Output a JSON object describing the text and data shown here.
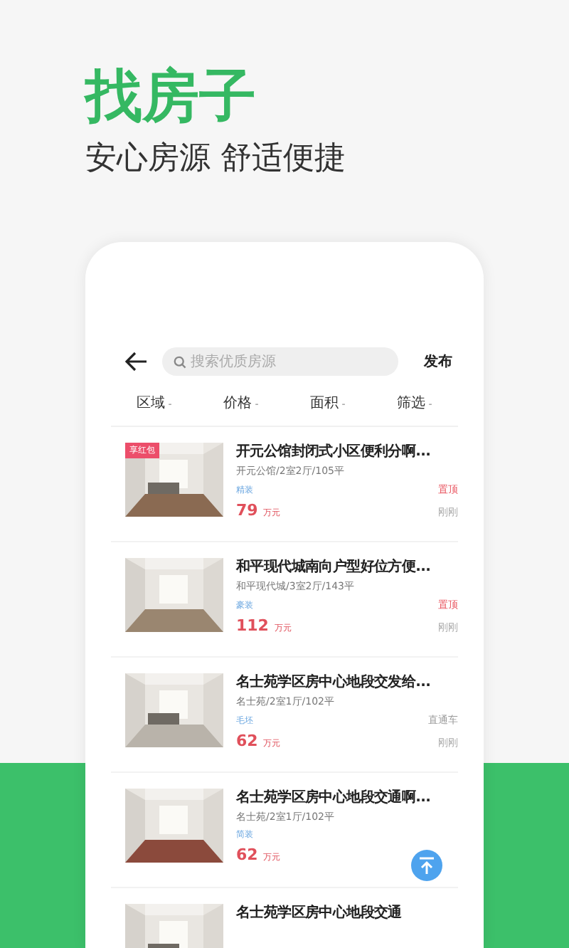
{
  "headline": "找房子",
  "tagline": "安心房源 舒适便捷",
  "header": {
    "search_placeholder": "搜索优质房源",
    "publish": "发布"
  },
  "filters": [
    {
      "label": "区域",
      "caret": "-"
    },
    {
      "label": "价格",
      "caret": "-"
    },
    {
      "label": "面积",
      "caret": "-"
    },
    {
      "label": "筛选",
      "caret": "-"
    }
  ],
  "listings": [
    {
      "title": "开元公馆封闭式小区便利分啊...",
      "meta": "开元公馆/2室2厅/105平",
      "tag": "精装",
      "price": "79",
      "unit": "万元",
      "badge": "享红包",
      "promo": {
        "text": "置顶",
        "kind": "top"
      },
      "time": "刚刚"
    },
    {
      "title": "和平现代城南向户型好位方便...",
      "meta": "和平现代城/3室2厅/143平",
      "tag": "豪装",
      "price": "112",
      "unit": "万元",
      "promo": {
        "text": "置顶",
        "kind": "top"
      },
      "time": "刚刚"
    },
    {
      "title": "名士苑学区房中心地段交发给...",
      "meta": "名士苑/2室1厅/102平",
      "tag": "毛坯",
      "price": "62",
      "unit": "万元",
      "promo": {
        "text": "直通车",
        "kind": "through"
      },
      "time": "刚刚"
    },
    {
      "title": "名士苑学区房中心地段交通啊...",
      "meta": "名士苑/2室1厅/102平",
      "tag": "简装",
      "price": "62",
      "unit": "万元"
    },
    {
      "title": "名士苑学区房中心地段交通"
    }
  ]
}
